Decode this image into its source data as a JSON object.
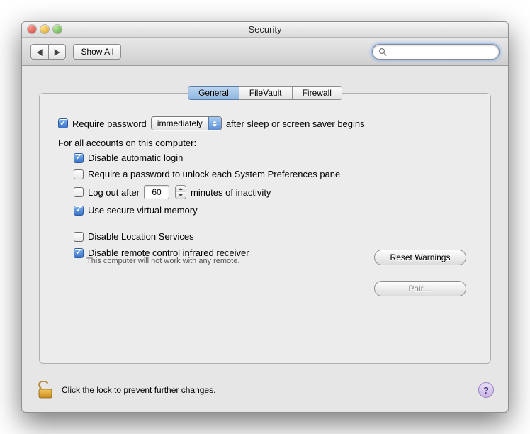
{
  "window": {
    "title": "Security"
  },
  "toolbar": {
    "show_all": "Show All",
    "search_placeholder": ""
  },
  "tabs": {
    "general": "General",
    "filevault": "FileVault",
    "firewall": "Firewall"
  },
  "general": {
    "require_password_label": "Require password",
    "require_password_delay": "immediately",
    "require_password_suffix": "after sleep or screen saver begins",
    "all_accounts_heading": "For all accounts on this computer:",
    "disable_auto_login": "Disable automatic login",
    "require_password_prefs": "Require a password to unlock each System Preferences pane",
    "log_out_prefix": "Log out after",
    "log_out_minutes": "60",
    "log_out_suffix": "minutes of inactivity",
    "secure_vm": "Use secure virtual memory",
    "disable_location": "Disable Location Services",
    "reset_warnings": "Reset Warnings",
    "disable_ir": "Disable remote control infrared receiver",
    "ir_subtext": "This computer will not work with any remote.",
    "pair": "Pair…"
  },
  "footer": {
    "lock_text": "Click the lock to prevent further changes.",
    "help": "?"
  },
  "checks": {
    "require_password": true,
    "disable_auto_login": true,
    "require_password_prefs": false,
    "log_out": false,
    "secure_vm": true,
    "disable_location": false,
    "disable_ir": true
  }
}
